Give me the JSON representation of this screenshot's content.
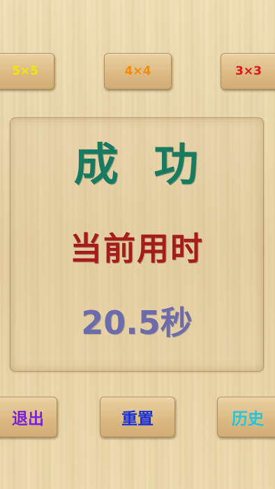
{
  "top_buttons": {
    "size_5": "5×5",
    "size_4": "4×4",
    "size_3": "3×3"
  },
  "result": {
    "title": "成  功",
    "label": "当前用时",
    "time": "20.5秒"
  },
  "bottom_buttons": {
    "exit": "退出",
    "reset": "重置",
    "history": "历史"
  },
  "colors": {
    "title": "#197a62",
    "label": "#a41c1c",
    "time": "#6b6ca9",
    "size_5": "#f2e600",
    "size_4": "#ff8a00",
    "size_3": "#e01515",
    "exit": "#7a1fd6",
    "reset": "#1a2fd4",
    "history": "#1ec6e0"
  }
}
